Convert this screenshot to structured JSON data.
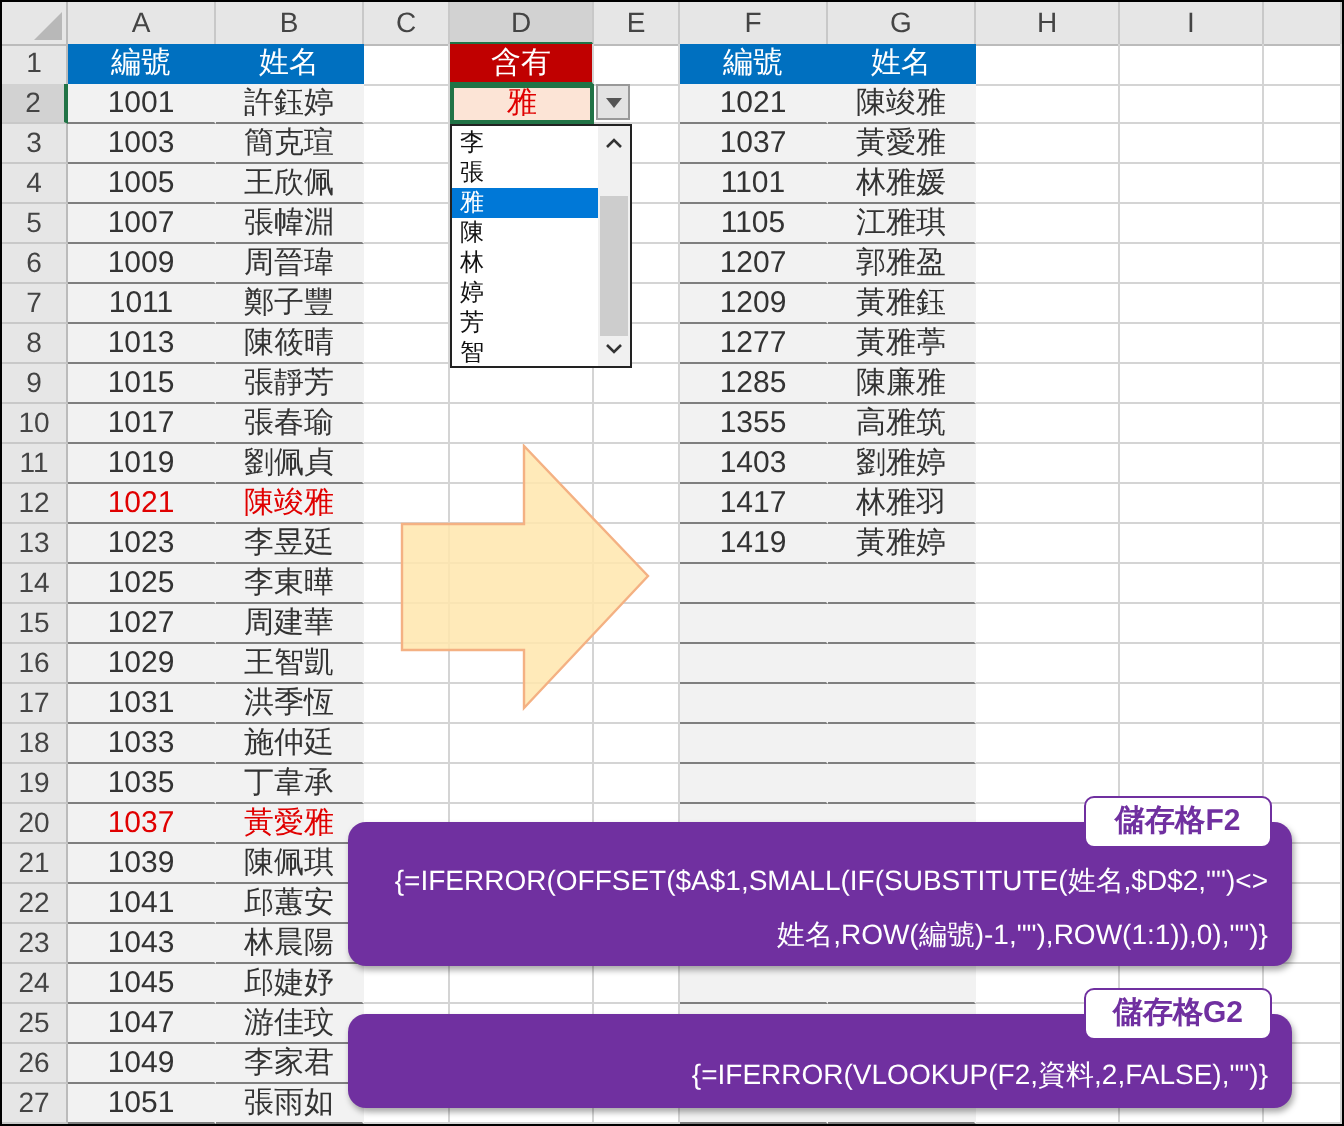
{
  "column_headers": [
    "A",
    "B",
    "C",
    "D",
    "E",
    "F",
    "G",
    "H",
    "I"
  ],
  "row_numbers": [
    "1",
    "2",
    "3",
    "4",
    "5",
    "6",
    "7",
    "8",
    "9",
    "10",
    "11",
    "12",
    "13",
    "14",
    "15",
    "16",
    "17",
    "18",
    "19",
    "20",
    "21",
    "22",
    "23",
    "24",
    "25",
    "26",
    "27"
  ],
  "source_table": {
    "header": [
      "編號",
      "姓名"
    ],
    "rows": [
      {
        "id": "1001",
        "name": "許鈺婷",
        "highlighted": false
      },
      {
        "id": "1003",
        "name": "簡克瑄",
        "highlighted": false
      },
      {
        "id": "1005",
        "name": "王欣佩",
        "highlighted": false
      },
      {
        "id": "1007",
        "name": "張幃淵",
        "highlighted": false
      },
      {
        "id": "1009",
        "name": "周晉瑋",
        "highlighted": false
      },
      {
        "id": "1011",
        "name": "鄭子豐",
        "highlighted": false
      },
      {
        "id": "1013",
        "name": "陳筱晴",
        "highlighted": false
      },
      {
        "id": "1015",
        "name": "張靜芳",
        "highlighted": false
      },
      {
        "id": "1017",
        "name": "張春瑜",
        "highlighted": false
      },
      {
        "id": "1019",
        "name": "劉佩貞",
        "highlighted": false
      },
      {
        "id": "1021",
        "name": "陳竣雅",
        "highlighted": true
      },
      {
        "id": "1023",
        "name": "李昱廷",
        "highlighted": false
      },
      {
        "id": "1025",
        "name": "李東曄",
        "highlighted": false
      },
      {
        "id": "1027",
        "name": "周建華",
        "highlighted": false
      },
      {
        "id": "1029",
        "name": "王智凱",
        "highlighted": false
      },
      {
        "id": "1031",
        "name": "洪季恆",
        "highlighted": false
      },
      {
        "id": "1033",
        "name": "施仲廷",
        "highlighted": false
      },
      {
        "id": "1035",
        "name": "丁韋承",
        "highlighted": false
      },
      {
        "id": "1037",
        "name": "黃愛雅",
        "highlighted": true
      },
      {
        "id": "1039",
        "name": "陳佩琪",
        "highlighted": false
      },
      {
        "id": "1041",
        "name": "邱蕙安",
        "highlighted": false
      },
      {
        "id": "1043",
        "name": "林晨陽",
        "highlighted": false
      },
      {
        "id": "1045",
        "name": "邱婕妤",
        "highlighted": false
      },
      {
        "id": "1047",
        "name": "游佳玟",
        "highlighted": false
      },
      {
        "id": "1049",
        "name": "李家君",
        "highlighted": false
      },
      {
        "id": "1051",
        "name": "張雨如",
        "highlighted": false
      }
    ]
  },
  "criteria": {
    "header": "含有",
    "value": "雅"
  },
  "dropdown": {
    "items": [
      {
        "label": "李",
        "selected": false
      },
      {
        "label": "張",
        "selected": false
      },
      {
        "label": "雅",
        "selected": true
      },
      {
        "label": "陳",
        "selected": false
      },
      {
        "label": "林",
        "selected": false
      },
      {
        "label": "婷",
        "selected": false
      },
      {
        "label": "芳",
        "selected": false
      },
      {
        "label": "智",
        "selected": false
      }
    ]
  },
  "result_table": {
    "header": [
      "編號",
      "姓名"
    ],
    "rows": [
      {
        "id": "1021",
        "name": "陳竣雅"
      },
      {
        "id": "1037",
        "name": "黃愛雅"
      },
      {
        "id": "1101",
        "name": "林雅媛"
      },
      {
        "id": "1105",
        "name": "江雅琪"
      },
      {
        "id": "1207",
        "name": "郭雅盈"
      },
      {
        "id": "1209",
        "name": "黃雅鈺"
      },
      {
        "id": "1277",
        "name": "黃雅葶"
      },
      {
        "id": "1285",
        "name": "陳廉雅"
      },
      {
        "id": "1355",
        "name": "高雅筑"
      },
      {
        "id": "1403",
        "name": "劉雅婷"
      },
      {
        "id": "1417",
        "name": "林雅羽"
      },
      {
        "id": "1419",
        "name": "黃雅婷"
      }
    ]
  },
  "callouts": [
    {
      "label": "儲存格F2",
      "lines": [
        "{=IFERROR(OFFSET($A$1,SMALL(IF(SUBSTITUTE(姓名,$D$2,\"\")<>",
        "姓名,ROW(編號)-1,\"\"),ROW(1:1)),0),\"\")}"
      ]
    },
    {
      "label": "儲存格G2",
      "lines": [
        "{=IFERROR(VLOOKUP(F2,資料,2,FALSE),\"\")}"
      ]
    }
  ]
}
